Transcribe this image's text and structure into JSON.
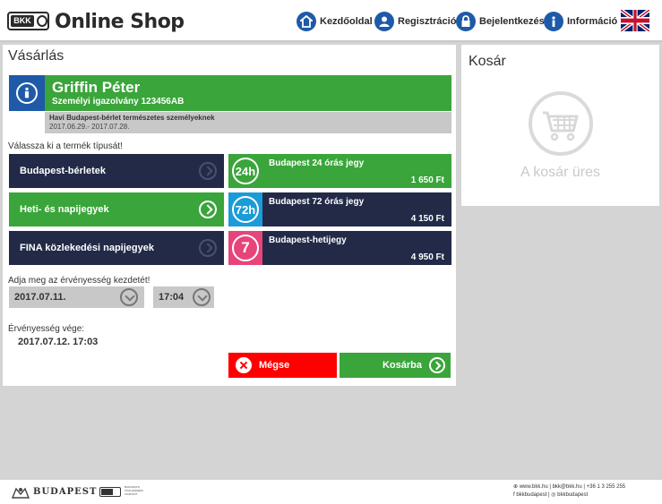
{
  "header": {
    "logo_text": "BKK",
    "brand": "Online Shop",
    "nav": [
      {
        "label": "Kezdőoldal",
        "icon": "home-icon"
      },
      {
        "label": "Regisztráció",
        "icon": "user-icon"
      },
      {
        "label": "Bejelentkezés",
        "icon": "lock-icon"
      },
      {
        "label": "Információ",
        "icon": "info-icon"
      }
    ],
    "language_flag": "uk-flag-icon"
  },
  "main": {
    "title": "Vásárlás",
    "user": {
      "name": "Griffin Péter",
      "id_label": "Személyi igazolvány 123456AB",
      "pass_title": "Havi Budapest-bérlet természetes személyeknek",
      "pass_dates": "2017.06.29.- 2017.07.28."
    },
    "type_prompt": "Válassza ki a termék típusát!",
    "categories": [
      {
        "label": "Budapest-bérletek",
        "active": false
      },
      {
        "label": "Heti- és napijegyek",
        "active": true
      },
      {
        "label": "FINA közlekedési napijegyek",
        "active": false
      }
    ],
    "tickets": [
      {
        "badge": "24h",
        "name": "Budapest 24 órás jegy",
        "price": "1 650 Ft",
        "badge_color": "#3aa53a"
      },
      {
        "badge": "72h",
        "name": "Budapest 72 órás jegy",
        "price": "4 150 Ft",
        "badge_color": "#1b9bd7"
      },
      {
        "badge": "7",
        "name": "Budapest-hetijegy",
        "price": "4 950 Ft",
        "badge_color": "#e6457a"
      }
    ],
    "validity_prompt": "Adja meg az érvényesség kezdetét!",
    "start_date": "2017.07.11.",
    "start_time": "17:04",
    "end_label": "Érvényesség vége:",
    "end_value": "2017.07.12. 17:03",
    "cancel_label": "Mégse",
    "add_label": "Kosárba"
  },
  "cart": {
    "title": "Kosár",
    "empty_text": "A kosár üres"
  },
  "footer": {
    "city": "BUDAPEST",
    "bkk_small": "BKK",
    "bkk_sub": [
      "BUDAPESTI",
      "KÖZLEKEDÉSI",
      "KÖZPONT"
    ],
    "contact_line1": "⊕ www.bkk.hu | bkk@bkk.hu | +36 1 3 255 255",
    "contact_line2": "f bkkbudapest | ◎ bkkbudapest"
  },
  "colors": {
    "green": "#3aa53a",
    "navy": "#222a47",
    "blue": "#1e5aa8",
    "red": "#ff0000"
  }
}
